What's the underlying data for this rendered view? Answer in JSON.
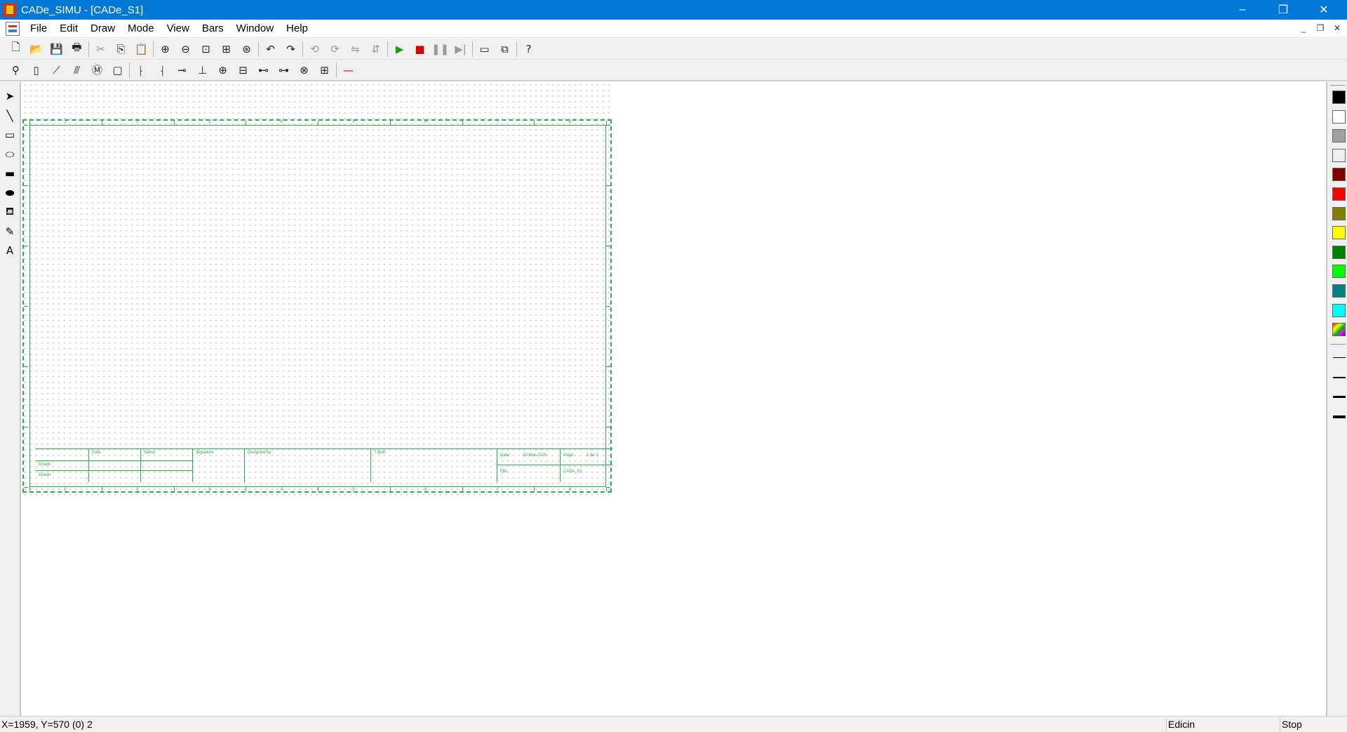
{
  "window": {
    "title": "CADe_SIMU - [CADe_S1]",
    "minimize": "–",
    "restore": "❐",
    "close": "✕"
  },
  "menu": {
    "items": [
      "File",
      "Edit",
      "Draw",
      "Mode",
      "View",
      "Bars",
      "Window",
      "Help"
    ]
  },
  "mdi": {
    "minimize": "_",
    "restore": "❐",
    "close": "✕"
  },
  "toolbar1": {
    "buttons": [
      {
        "name": "new-file-icon",
        "glyph": "🗋"
      },
      {
        "name": "open-folder-icon",
        "glyph": "📂"
      },
      {
        "name": "save-icon",
        "glyph": "💾"
      },
      {
        "name": "print-icon",
        "glyph": "🖶"
      },
      {
        "name": "cut-icon",
        "glyph": "✂",
        "dim": true
      },
      {
        "name": "copy-icon",
        "glyph": "⎘"
      },
      {
        "name": "paste-icon",
        "glyph": "📋"
      },
      {
        "name": "zoom-in-icon",
        "glyph": "⊕"
      },
      {
        "name": "zoom-out-icon",
        "glyph": "⊖"
      },
      {
        "name": "zoom-window-icon",
        "glyph": "⊡"
      },
      {
        "name": "zoom-page-icon",
        "glyph": "⊞"
      },
      {
        "name": "zoom-all-icon",
        "glyph": "⊛"
      },
      {
        "name": "undo-icon",
        "glyph": "↶"
      },
      {
        "name": "redo-icon",
        "glyph": "↷"
      },
      {
        "name": "rotate-left-icon",
        "glyph": "⟲",
        "dim": true
      },
      {
        "name": "rotate-right-icon",
        "glyph": "⟳",
        "dim": true
      },
      {
        "name": "mirror-horizontal-icon",
        "glyph": "⇋",
        "dim": true
      },
      {
        "name": "mirror-vertical-icon",
        "glyph": "⇵",
        "dim": true
      },
      {
        "name": "play-icon",
        "glyph": "▶",
        "color": "#1a9e1a"
      },
      {
        "name": "stop-icon",
        "glyph": "■",
        "color": "#d40000"
      },
      {
        "name": "pause-icon",
        "glyph": "❚❚",
        "dim": true
      },
      {
        "name": "step-icon",
        "glyph": "▶|",
        "dim": true
      },
      {
        "name": "window-icon",
        "glyph": "▭"
      },
      {
        "name": "windows-icon",
        "glyph": "⧉"
      },
      {
        "name": "help-icon",
        "glyph": "?"
      }
    ]
  },
  "toolbar2": {
    "buttons": [
      {
        "name": "push-button-icon",
        "glyph": "⚲"
      },
      {
        "name": "fuse-icon",
        "glyph": "▯"
      },
      {
        "name": "switch-icon",
        "glyph": "⟋"
      },
      {
        "name": "three-phase-switch-icon",
        "glyph": "⫻"
      },
      {
        "name": "motor-icon",
        "glyph": "Ⓜ"
      },
      {
        "name": "relay-coil-icon",
        "glyph": "▢"
      },
      {
        "name": "contact-icon",
        "glyph": "⸠"
      },
      {
        "name": "contact-nc-icon",
        "glyph": "⸡"
      },
      {
        "name": "diode-icon",
        "glyph": "⊸"
      },
      {
        "name": "junction-icon",
        "glyph": "⊥"
      },
      {
        "name": "node-icon",
        "glyph": "⊕"
      },
      {
        "name": "terminal-icon",
        "glyph": "⊟"
      },
      {
        "name": "sensor-icon",
        "glyph": "⊷"
      },
      {
        "name": "resistor-icon",
        "glyph": "⊶"
      },
      {
        "name": "lamp-icon",
        "glyph": "⊗"
      },
      {
        "name": "connector-icon",
        "glyph": "⊞"
      },
      {
        "name": "wire-icon",
        "glyph": "—",
        "color": "#d40000"
      }
    ]
  },
  "left_palette": {
    "tools": [
      {
        "name": "select-arrow-icon",
        "glyph": "➤"
      },
      {
        "name": "line-icon",
        "glyph": "╲"
      },
      {
        "name": "rectangle-icon",
        "glyph": "▭"
      },
      {
        "name": "ellipse-icon",
        "glyph": "⬭"
      },
      {
        "name": "filled-rectangle-icon",
        "glyph": "▬"
      },
      {
        "name": "filled-ellipse-icon",
        "glyph": "⬬"
      },
      {
        "name": "fill-bucket-icon",
        "glyph": "⛾"
      },
      {
        "name": "pen-icon",
        "glyph": "✎"
      },
      {
        "name": "text-icon",
        "glyph": "A"
      }
    ]
  },
  "right_palette": {
    "colors": [
      "#000000",
      "#ffffff",
      "#a0a0a0",
      "#f0f0f0",
      "#800000",
      "#ff0000",
      "#808000",
      "#ffff00",
      "#008000",
      "#00ff00",
      "#008080",
      "#00ffff"
    ],
    "line_widths": [
      1,
      2,
      3,
      4
    ]
  },
  "drawing": {
    "ruler_numbers": [
      "1",
      "2",
      "3",
      "4",
      "5",
      "6",
      "7",
      "8"
    ],
    "titleblock": {
      "date_label": "Date",
      "name_label": "Name",
      "signature_label": "Signature",
      "designed_by_label": "Designed by:",
      "title_label": "T.duth",
      "drawn_label": "Drawn",
      "drawn_label2": "Drawn",
      "date2_label": "Date:",
      "date_value": "23-Mar-2020",
      "page_label": "Page:",
      "page_value": "1 de 1",
      "file_label": "File:",
      "file_value": "CADe_S1"
    }
  },
  "status": {
    "coords": "X=1959, Y=570 (0) 2",
    "mode": "Edicin",
    "sim_state": "Stop"
  }
}
